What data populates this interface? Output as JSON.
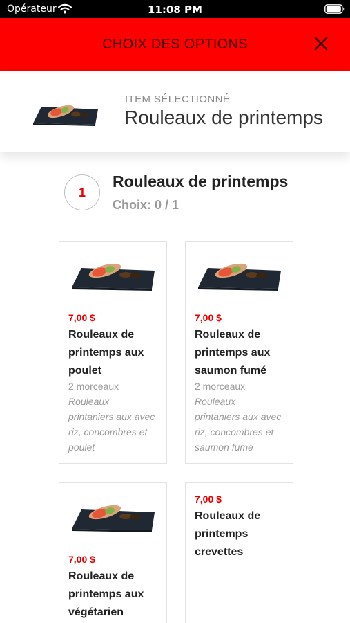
{
  "status_bar": {
    "carrier": "Opérateur",
    "time": "11:08 PM"
  },
  "header": {
    "title": "CHOIX DES OPTIONS",
    "close_icon": "close-icon",
    "color": "#ff0000"
  },
  "selected_item": {
    "caption": "ITEM SÉLECTIONNÉ",
    "name": "Rouleaux de printemps"
  },
  "section": {
    "step": "1",
    "title": "Rouleaux de printemps",
    "count": "Choix: 0 / 1"
  },
  "options": [
    {
      "price": "7,00 $",
      "name_lines": [
        "Rouleaux de",
        "printemps aux",
        "poulet"
      ],
      "qty": "2 morceaux",
      "desc_lines": [
        "Rouleaux",
        "printaniers aux avec",
        "riz, concombres et",
        "poulet"
      ]
    },
    {
      "price": "7,00 $",
      "name_lines": [
        "Rouleaux de",
        "printemps aux",
        "saumon fumé"
      ],
      "qty": "2 morceaux",
      "desc_lines": [
        "Rouleaux",
        "printaniers aux avec",
        "riz, concombres et",
        "saumon fumé"
      ]
    },
    {
      "price": "7,00 $",
      "name_lines": [
        "Rouleaux de",
        "printemps aux",
        "végétarien"
      ]
    },
    {
      "price": "7,00 $",
      "name_lines": [
        "Rouleaux de",
        "printemps",
        "crevettes"
      ]
    }
  ]
}
